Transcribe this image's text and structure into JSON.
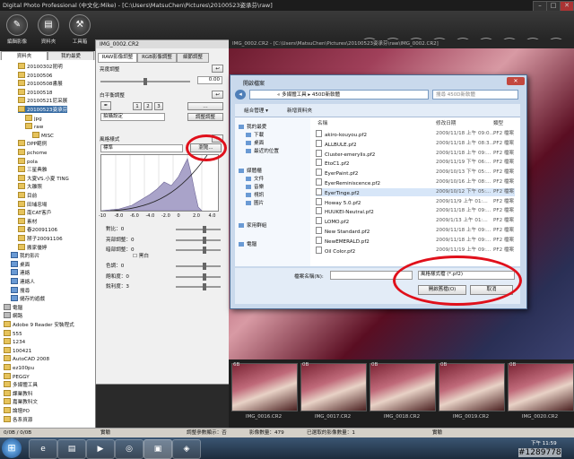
{
  "app": {
    "title": "Digital Photo Professional (中文化:Mike) - [C:\\Users\\MatsuChen\\Pictures\\20100523姿承芬\\raw]"
  },
  "toolbar": {
    "left_tools": [
      "編輯影像",
      "資料夾",
      "工具箱"
    ],
    "right_icons": [
      "edit-icon",
      "image-icon",
      "tools-icon",
      "convert-icon",
      "print-icon",
      "transfer-icon",
      "eos-icon",
      "display-icon",
      "fullscreen-icon",
      "quick-check-icon"
    ]
  },
  "sidebar": {
    "tabs": [
      "資料夾",
      "我的最愛"
    ],
    "items": [
      {
        "label": "20100302昆明",
        "level": 2,
        "kind": "folder"
      },
      {
        "label": "20100506",
        "level": 2,
        "kind": "folder"
      },
      {
        "label": "20100508書展",
        "level": 2,
        "kind": "folder"
      },
      {
        "label": "20100518",
        "level": 2,
        "kind": "folder"
      },
      {
        "label": "20100521尼采展",
        "level": 2,
        "kind": "folder"
      },
      {
        "label": "20100523姿承芬",
        "level": 2,
        "kind": "folder",
        "selected": true
      },
      {
        "label": "jpg",
        "level": 3,
        "kind": "folder"
      },
      {
        "label": "raw",
        "level": 3,
        "kind": "folder"
      },
      {
        "label": "MISC",
        "level": 4,
        "kind": "folder"
      },
      {
        "label": "DPP範例",
        "level": 2,
        "kind": "folder"
      },
      {
        "label": "pchome",
        "level": 2,
        "kind": "folder"
      },
      {
        "label": "pola",
        "level": 2,
        "kind": "folder"
      },
      {
        "label": "三星典雅",
        "level": 2,
        "kind": "folder"
      },
      {
        "label": "大夏VS.小夏 TING",
        "level": 2,
        "kind": "folder"
      },
      {
        "label": "大雕照",
        "level": 2,
        "kind": "folder"
      },
      {
        "label": "目前",
        "level": 2,
        "kind": "folder"
      },
      {
        "label": "田埔忠場",
        "level": 2,
        "kind": "folder"
      },
      {
        "label": "南CAT客戶",
        "level": 2,
        "kind": "folder"
      },
      {
        "label": "素材",
        "level": 2,
        "kind": "folder"
      },
      {
        "label": "春20091106",
        "level": 2,
        "kind": "folder"
      },
      {
        "label": "掰子20091106",
        "level": 2,
        "kind": "folder"
      },
      {
        "label": "搬家優婷",
        "level": 2,
        "kind": "folder"
      },
      {
        "label": "我的影片",
        "level": 1,
        "kind": "blue"
      },
      {
        "label": "桌面",
        "level": 1,
        "kind": "blue"
      },
      {
        "label": "連絡",
        "level": 1,
        "kind": "blue"
      },
      {
        "label": "連絡人",
        "level": 1,
        "kind": "blue"
      },
      {
        "label": "搜尋",
        "level": 1,
        "kind": "blue"
      },
      {
        "label": "儲存的遊戲",
        "level": 1,
        "kind": "blue"
      },
      {
        "label": "電腦",
        "level": 0,
        "kind": "gray"
      },
      {
        "label": "網路",
        "level": 0,
        "kind": "gray"
      },
      {
        "label": "Adobe 9 Reader 安裝程式",
        "level": 0,
        "kind": "folder"
      },
      {
        "label": "555",
        "level": 0,
        "kind": "folder"
      },
      {
        "label": "1234",
        "level": 0,
        "kind": "folder"
      },
      {
        "label": "100421",
        "level": 0,
        "kind": "folder"
      },
      {
        "label": "AutoCAD 2008",
        "level": 0,
        "kind": "folder"
      },
      {
        "label": "ez100pu",
        "level": 0,
        "kind": "folder"
      },
      {
        "label": "PEGGY",
        "level": 0,
        "kind": "folder"
      },
      {
        "label": "多媒體工具",
        "level": 0,
        "kind": "folder"
      },
      {
        "label": "課業教科",
        "level": 0,
        "kind": "folder"
      },
      {
        "label": "嘉業教科文",
        "level": 0,
        "kind": "folder"
      },
      {
        "label": "論壇PO",
        "level": 0,
        "kind": "folder"
      },
      {
        "label": "各系資源",
        "level": 0,
        "kind": "folder"
      }
    ]
  },
  "panel": {
    "title": "IMG_0002.CR2",
    "tabs": [
      "RAW影像調整",
      "RGB影像調整",
      "細節調整"
    ],
    "brightness_label": "亮度調整",
    "brightness_value": "0.00",
    "wb_label": "白平衡調整",
    "wb_preset": "拍攝設定",
    "wb_button": "調整調整",
    "style_label": "風格樣式",
    "style_value": "標準",
    "browse_button": "瀏覽...",
    "axis": [
      "-10",
      "-8.0",
      "-6.0",
      "-4.0",
      "-2.0",
      "0",
      "2.0",
      "4.0"
    ],
    "sliders": [
      {
        "label": "對比：",
        "value": "0"
      },
      {
        "label": "亮部調整：",
        "value": "0"
      },
      {
        "label": "暗部調整：",
        "value": "0"
      },
      {
        "label": "色調：",
        "value": "0"
      },
      {
        "label": "飽和度：",
        "value": "0"
      },
      {
        "label": "銳利度：",
        "value": "3"
      }
    ],
    "mono_label": "黑白"
  },
  "photo": {
    "header": "IMG_0002.CR2 - [C:\\Users\\MatsuChen\\Pictures\\20100523姿承芬\\raw\\IMG_0002.CR2]"
  },
  "dialog": {
    "title": "開啟檔案",
    "breadcrumb": "« 多媒體工具 ▸ 450D新軟體",
    "search_placeholder": "搜尋 450D新軟體",
    "organize": "組合管理 ▾",
    "new_folder": "新增資料夾",
    "nav": [
      "我的最愛",
      "下載",
      "桌面",
      "最近的位置",
      "媒體櫃",
      "文件",
      "音樂",
      "視訊",
      "圖片",
      "家用群組",
      "電腦"
    ],
    "columns": [
      "名稱",
      "修改日期",
      "類型"
    ],
    "files": [
      {
        "name": "akiro-kouyou.pf2",
        "date": "2009/11/18 上午 09:0...",
        "type": "PF2 檔案"
      },
      {
        "name": "ALLBULE.pf2",
        "date": "2009/11/18 上午 08:3...",
        "type": "PF2 檔案"
      },
      {
        "name": "Cluster-emerylis.pf2",
        "date": "2009/11/18 上午 09:...",
        "type": "PF2 檔案"
      },
      {
        "name": "EtoC1.pf2",
        "date": "2009/11/19 下午 06:...",
        "type": "PF2 檔案"
      },
      {
        "name": "EyerPaint.pf2",
        "date": "2009/10/13 下午 05:...",
        "type": "PF2 檔案"
      },
      {
        "name": "EyerReminiscence.pf2",
        "date": "2009/10/16 上午 08:...",
        "type": "PF2 檔案"
      },
      {
        "name": "EyerTinge.pf2",
        "date": "2009/10/12 下午 05:...",
        "type": "PF2 檔案"
      },
      {
        "name": "Howay 5.0.pf2",
        "date": "2009/11/9 上午 01:...",
        "type": "PF2 檔案"
      },
      {
        "name": "HUUKEI-Neutral.pf2",
        "date": "2009/11/18 上午 09:...",
        "type": "PF2 檔案"
      },
      {
        "name": "LOMO.pf2",
        "date": "2009/1/13 上午 01:...",
        "type": "PF2 檔案"
      },
      {
        "name": "New Standard.pf2",
        "date": "2009/11/18 上午 09:...",
        "type": "PF2 檔案"
      },
      {
        "name": "NewEMERALD.pf2",
        "date": "2009/11/18 上午 09:...",
        "type": "PF2 檔案"
      },
      {
        "name": "Oil Color.pf2",
        "date": "2009/11/19 上午 09:...",
        "type": "PF2 檔案"
      }
    ],
    "filename_label": "檔案名稱(N):",
    "filetype": "風格樣式檔 (*.pf2)",
    "open_button": "開啟舊檔(O)",
    "cancel_button": "取消"
  },
  "filmstrip": {
    "groups": [
      "6B",
      "0B",
      "0B",
      "0B",
      "0B"
    ],
    "thumbs": [
      "IMG_0016.CR2",
      "IMG_0017.CR2",
      "IMG_0018.CR2",
      "IMG_0019.CR2",
      "IMG_0020.CR2"
    ]
  },
  "statusbar": {
    "left": "0/0B / 0/0B",
    "mid1": "實驗",
    "mid2": "調整參數顯示：否",
    "mid3": "影像數量：479",
    "mid4": "已選取的影像數量：1",
    "right": "實驗"
  },
  "taskbar": {
    "start": "⊞",
    "watermark": "#1289778",
    "clock": "下午 11:59"
  },
  "colors": {
    "highlight": "#e0101b",
    "selection": "#3a6ea5"
  }
}
